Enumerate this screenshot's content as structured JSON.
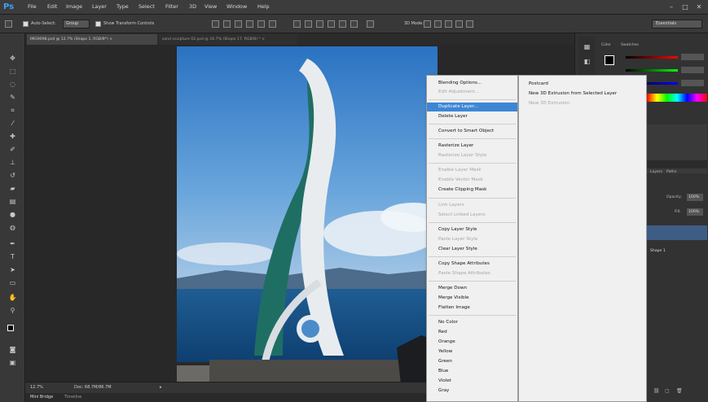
{
  "app": {
    "logo": "Ps",
    "colors": {
      "accent": "#3d86d6",
      "highlight_text": "#ffffff"
    }
  },
  "menubar": {
    "items": [
      "File",
      "Edit",
      "Image",
      "Layer",
      "Type",
      "Select",
      "Filter",
      "3D",
      "View",
      "Window",
      "Help"
    ],
    "window_controls": {
      "minimize": "–",
      "maximize": "□",
      "close": "✕"
    }
  },
  "options_bar": {
    "auto_select_label": "Auto-Select:",
    "auto_select_value": "Group",
    "show_transform_label": "Show Transform Controls",
    "mode_3d_label": "3D Mode:",
    "workspace_value": "Essentials"
  },
  "tabs": [
    {
      "label": "IMG9098.psd @ 12.7% (Shape 1, RGB/8*)",
      "close": "×",
      "active": true
    },
    {
      "label": "sand sculpture 02.psd @ 16.7% (Shape 17, RGB/8) *",
      "close": "×",
      "active": false
    }
  ],
  "status": {
    "zoom": "12.7%",
    "doc_size": "Doc: 68.7M/86.7M",
    "arrow": "▸"
  },
  "bottom_tabs": [
    "Mini Bridge",
    "Timeline"
  ],
  "context_menu": {
    "items": [
      {
        "label": "Blending Options...",
        "disabled": false
      },
      {
        "label": "Edit Adjustment...",
        "disabled": true
      },
      {
        "label": "Duplicate Layer...",
        "disabled": false,
        "highlighted": true
      },
      {
        "label": "Delete Layer",
        "disabled": false
      },
      {
        "label": "Convert to Smart Object",
        "disabled": false
      },
      {
        "label": "Rasterize Layer",
        "disabled": false
      },
      {
        "label": "Rasterize Layer Style",
        "disabled": true
      },
      {
        "label": "Enable Layer Mask",
        "disabled": true
      },
      {
        "label": "Enable Vector Mask",
        "disabled": true
      },
      {
        "label": "Create Clipping Mask",
        "disabled": false
      },
      {
        "label": "Link Layers",
        "disabled": true
      },
      {
        "label": "Select Linked Layers",
        "disabled": true
      },
      {
        "label": "Copy Layer Style",
        "disabled": false
      },
      {
        "label": "Paste Layer Style",
        "disabled": true
      },
      {
        "label": "Clear Layer Style",
        "disabled": false
      },
      {
        "label": "Copy Shape Attributes",
        "disabled": false
      },
      {
        "label": "Paste Shape Attributes",
        "disabled": true
      },
      {
        "label": "Merge Down",
        "disabled": false
      },
      {
        "label": "Merge Visible",
        "disabled": false
      },
      {
        "label": "Flatten Image",
        "disabled": false
      },
      {
        "label": "No Color",
        "disabled": false
      },
      {
        "label": "Red",
        "disabled": false
      },
      {
        "label": "Orange",
        "disabled": false
      },
      {
        "label": "Yellow",
        "disabled": false
      },
      {
        "label": "Green",
        "disabled": false
      },
      {
        "label": "Blue",
        "disabled": false
      },
      {
        "label": "Violet",
        "disabled": false
      },
      {
        "label": "Gray",
        "disabled": false
      }
    ]
  },
  "submenu": {
    "items": [
      {
        "label": "Postcard",
        "disabled": false
      },
      {
        "label": "New 3D Extrusion from Selected Layer",
        "disabled": false
      },
      {
        "label": "New 3D Extrusion",
        "disabled": true
      }
    ]
  },
  "panels": {
    "color_tabs": [
      "Color",
      "Swatches"
    ],
    "layers_tabs": [
      "Layers",
      "Paths"
    ],
    "opacity_label": "Opacity:",
    "opacity_value": "100%",
    "fill_label": "Fill:",
    "fill_value": "100%",
    "layer_name": "Shape 1"
  }
}
